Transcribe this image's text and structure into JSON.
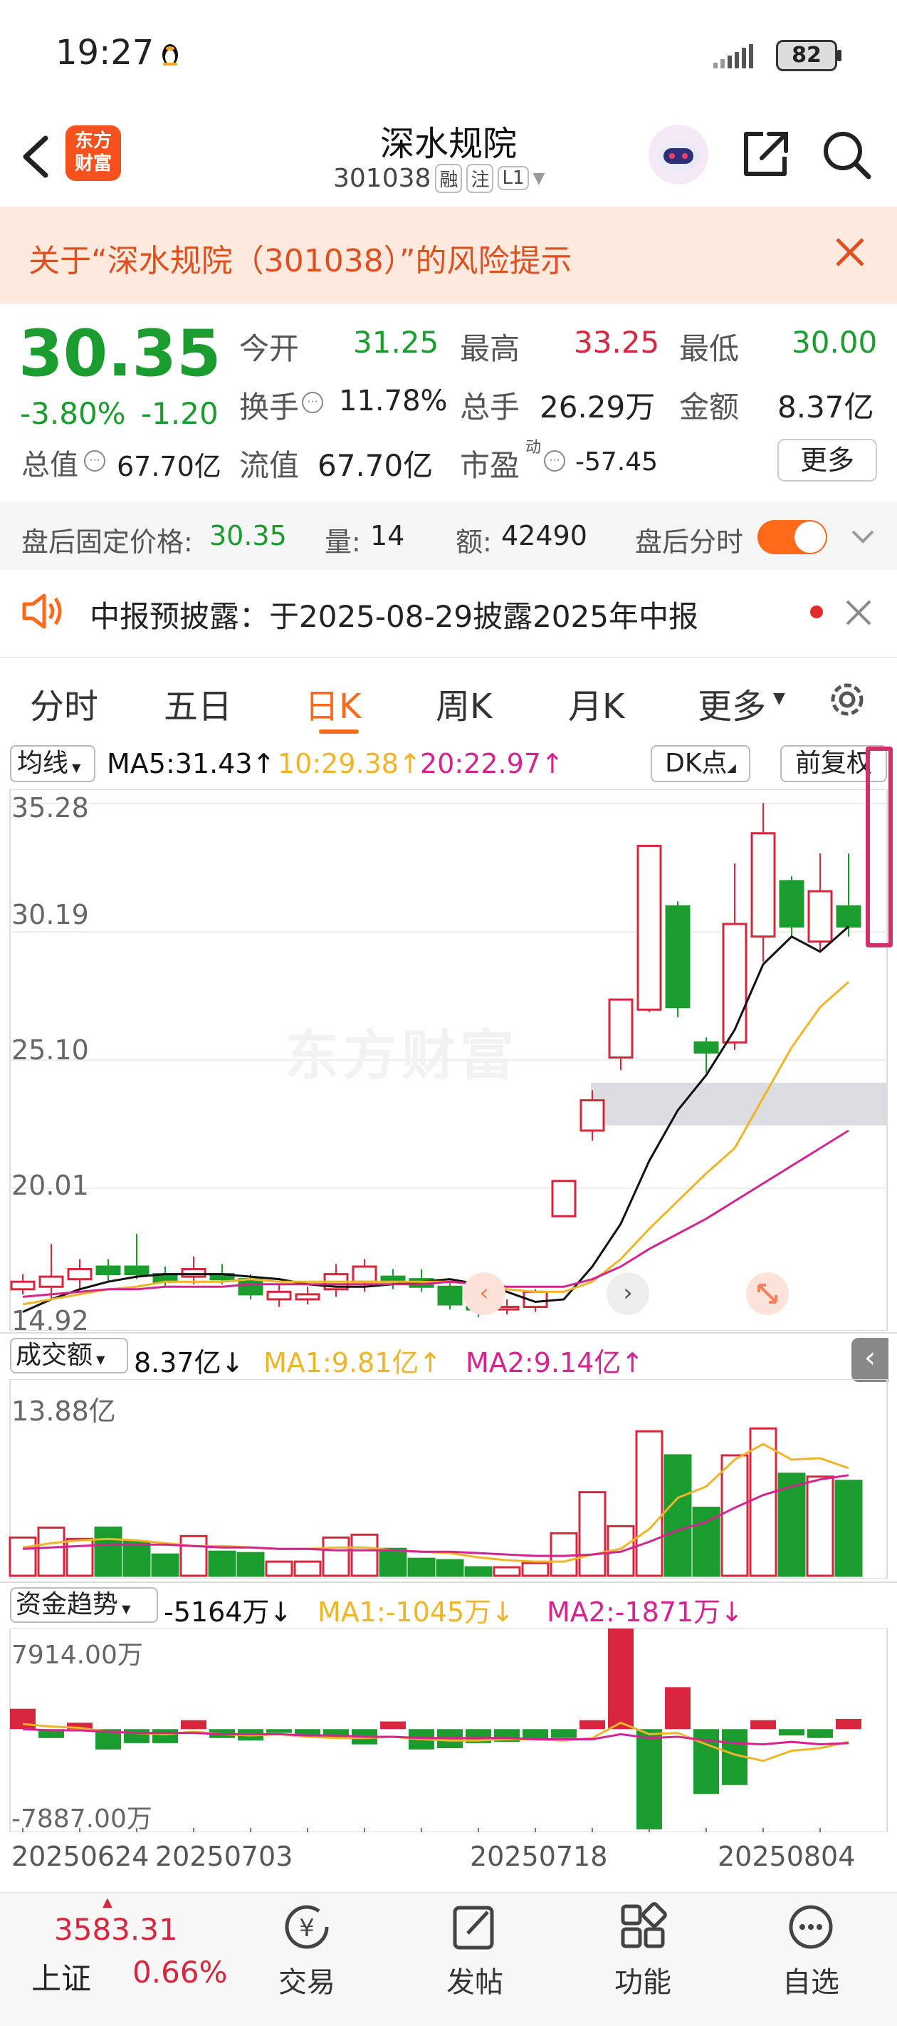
{
  "status_bar": {
    "time": "19:27",
    "battery": "82"
  },
  "header": {
    "logo_line1": "东方",
    "logo_line2": "财富",
    "title": "深水规院",
    "code": "301038",
    "tag1": "融",
    "tag2": "注",
    "tag3": "L1"
  },
  "banner": {
    "text": "关于“深水规院（301038）”的风险提示"
  },
  "quote": {
    "price": "30.35",
    "change_pct": "-3.80%",
    "change": "-1.20",
    "open_label": "今开",
    "open": "31.25",
    "high_label": "最高",
    "high": "33.25",
    "low_label": "最低",
    "low": "30.00",
    "turnover_label": "换手",
    "turnover": "11.78%",
    "volume_label": "总手",
    "volume": "26.29万",
    "amount_label": "金额",
    "amount": "8.37亿",
    "mktcap_label": "总值",
    "mktcap": "67.70亿",
    "float_label": "流值",
    "float": "67.70亿",
    "pe_label": "市盈",
    "pe_sup": "动",
    "pe": "-57.45",
    "more": "更多"
  },
  "after_hours": {
    "price_label": "盘后固定价格:",
    "price": "30.35",
    "qty_label": "量:",
    "qty": "14",
    "amt_label": "额:",
    "amt": "42490",
    "toggle_label": "盘后分时"
  },
  "notice": {
    "text": "中报预披露：于2025-08-29披露2025年中报"
  },
  "tabs": [
    "分时",
    "五日",
    "日K",
    "周K",
    "月K",
    "更多"
  ],
  "chart_toolbar": {
    "indicator": "均线",
    "ma5": "MA5:31.43↑",
    "ma10": "10:29.38↑",
    "ma20": "20:22.97↑",
    "dk": "DK点",
    "adjust": "前复权"
  },
  "price_axis": [
    "35.28",
    "30.19",
    "25.10",
    "20.01",
    "14.92"
  ],
  "vol_toolbar": {
    "label": "成交额",
    "value": "8.37亿↓",
    "ma1": "MA1:9.81亿↑",
    "ma2": "MA2:9.14亿↑"
  },
  "vol_axis": {
    "max": "13.88亿"
  },
  "flow_toolbar": {
    "label": "资金趋势",
    "value": "-5164万↓",
    "ma1": "MA1:-1045万↓",
    "ma2": "MA2:-1871万↓"
  },
  "flow_axis": {
    "max": "7914.00万",
    "min": "-7887.00万"
  },
  "dates": [
    "20250624",
    "20250703",
    "20250718",
    "20250804"
  ],
  "watermark": "东方财富",
  "bottom": {
    "index_value": "3583.31",
    "index_name": "上证",
    "index_pct": "0.66%",
    "nav": [
      "交易",
      "发帖",
      "功能",
      "自选"
    ]
  },
  "colors": {
    "up": "#d7263d",
    "down": "#1a9d2e",
    "ma5": "#111111",
    "ma10": "#f0b428",
    "ma20": "#d6248f",
    "accent": "#ff6a1a"
  },
  "chart_data": {
    "type": "candlestick",
    "ylim": [
      14.92,
      35.28
    ],
    "candles": [
      {
        "o": 16.0,
        "c": 16.3,
        "h": 16.6,
        "l": 15.8
      },
      {
        "o": 16.1,
        "c": 16.5,
        "h": 17.8,
        "l": 15.6
      },
      {
        "o": 16.4,
        "c": 16.8,
        "h": 17.2,
        "l": 16.0
      },
      {
        "o": 16.9,
        "c": 16.6,
        "h": 17.2,
        "l": 16.3
      },
      {
        "o": 16.9,
        "c": 16.6,
        "h": 18.2,
        "l": 16.4
      },
      {
        "o": 16.6,
        "c": 16.3,
        "h": 16.9,
        "l": 16.1
      },
      {
        "o": 16.5,
        "c": 16.8,
        "h": 17.3,
        "l": 16.2
      },
      {
        "o": 16.6,
        "c": 16.4,
        "h": 17.0,
        "l": 16.2
      },
      {
        "o": 16.4,
        "c": 15.8,
        "h": 16.6,
        "l": 15.6
      },
      {
        "o": 15.6,
        "c": 15.9,
        "h": 16.2,
        "l": 15.3
      },
      {
        "o": 15.6,
        "c": 15.8,
        "h": 16.1,
        "l": 15.4
      },
      {
        "o": 16.0,
        "c": 16.6,
        "h": 17.0,
        "l": 15.7
      },
      {
        "o": 16.3,
        "c": 16.9,
        "h": 17.2,
        "l": 15.9
      },
      {
        "o": 16.5,
        "c": 16.3,
        "h": 16.8,
        "l": 16.0
      },
      {
        "o": 16.4,
        "c": 16.1,
        "h": 16.8,
        "l": 15.9
      },
      {
        "o": 16.1,
        "c": 15.4,
        "h": 16.3,
        "l": 15.2
      },
      {
        "o": 15.3,
        "c": 15.2,
        "h": 15.5,
        "l": 14.9
      },
      {
        "o": 15.2,
        "c": 15.3,
        "h": 15.6,
        "l": 15.0
      },
      {
        "o": 15.3,
        "c": 15.9,
        "h": 16.0,
        "l": 15.1
      },
      {
        "o": 18.9,
        "c": 20.3,
        "h": 20.3,
        "l": 18.9
      },
      {
        "o": 22.3,
        "c": 23.5,
        "h": 23.9,
        "l": 21.9
      },
      {
        "o": 25.2,
        "c": 27.5,
        "h": 27.5,
        "l": 24.7
      },
      {
        "o": 27.1,
        "c": 33.6,
        "h": 33.6,
        "l": 27.0
      },
      {
        "o": 31.2,
        "c": 27.2,
        "h": 31.4,
        "l": 26.8
      },
      {
        "o": 25.8,
        "c": 25.4,
        "h": 26.0,
        "l": 24.6
      },
      {
        "o": 25.8,
        "c": 30.5,
        "h": 32.9,
        "l": 25.5
      },
      {
        "o": 30.0,
        "c": 34.1,
        "h": 35.3,
        "l": 29.0
      },
      {
        "o": 32.2,
        "c": 30.4,
        "h": 32.4,
        "l": 30.0
      },
      {
        "o": 29.8,
        "c": 31.8,
        "h": 33.3,
        "l": 29.4
      },
      {
        "o": 31.2,
        "c": 30.4,
        "h": 33.3,
        "l": 30.0
      }
    ],
    "ma5": [
      15.1,
      15.6,
      16.0,
      16.3,
      16.5,
      16.6,
      16.6,
      16.6,
      16.5,
      16.4,
      16.2,
      16.1,
      16.1,
      16.2,
      16.3,
      16.4,
      16.2,
      15.9,
      15.5,
      15.6,
      16.9,
      18.6,
      21.1,
      23.1,
      24.5,
      26.3,
      28.9,
      30.0,
      29.4,
      30.4,
      31.4
    ],
    "ma10": [
      15.4,
      15.6,
      15.8,
      16.0,
      16.1,
      16.3,
      16.3,
      16.3,
      16.4,
      16.3,
      16.3,
      16.3,
      16.3,
      16.3,
      16.3,
      16.3,
      16.2,
      16.0,
      15.9,
      15.9,
      16.3,
      17.2,
      18.4,
      19.5,
      20.6,
      21.6,
      23.6,
      25.6,
      27.2,
      28.2,
      29.4
    ],
    "ma20": [
      15.7,
      15.8,
      15.9,
      16.0,
      16.0,
      16.1,
      16.1,
      16.1,
      16.2,
      16.2,
      16.2,
      16.2,
      16.2,
      16.2,
      16.2,
      16.3,
      16.2,
      16.1,
      16.1,
      16.1,
      16.4,
      16.9,
      17.6,
      18.2,
      18.8,
      19.5,
      20.2,
      20.9,
      21.6,
      22.3,
      23.0
    ],
    "volume": [
      2.7,
      3.4,
      2.6,
      3.4,
      2.4,
      1.5,
      2.8,
      1.7,
      1.6,
      1.0,
      1.0,
      2.7,
      2.9,
      1.9,
      1.2,
      1.1,
      0.6,
      0.6,
      0.9,
      3.0,
      5.9,
      3.5,
      10.2,
      8.5,
      4.8,
      8.5,
      10.4,
      7.2,
      7.0,
      6.7
    ],
    "volume_ma1": [
      2.0,
      2.3,
      2.5,
      2.6,
      2.5,
      2.3,
      2.1,
      2.1,
      2.0,
      1.9,
      1.9,
      2.0,
      2.0,
      1.8,
      1.7,
      1.6,
      1.3,
      1.1,
      1.0,
      1.0,
      1.5,
      1.9,
      3.3,
      5.5,
      6.3,
      8.2,
      9.3,
      8.2,
      8.3,
      7.6,
      7.8
    ],
    "volume_ma2": [
      1.9,
      2.0,
      2.1,
      2.2,
      2.2,
      2.2,
      2.1,
      2.0,
      2.0,
      1.9,
      1.9,
      1.8,
      1.8,
      1.8,
      1.7,
      1.7,
      1.6,
      1.5,
      1.4,
      1.4,
      1.5,
      1.7,
      2.4,
      3.2,
      3.8,
      4.8,
      5.7,
      6.3,
      6.8,
      7.1,
      7.4
    ],
    "flow": [
      1600,
      -700,
      500,
      -1600,
      -1100,
      -1100,
      700,
      -700,
      -900,
      -300,
      -600,
      -700,
      -1200,
      600,
      -1600,
      -1500,
      -1100,
      -1000,
      -800,
      -700,
      700,
      7914,
      -7887,
      3300,
      -5100,
      -4400,
      700,
      -500,
      -700,
      800,
      -5164
    ],
    "flow_ma1": [
      400,
      200,
      100,
      -200,
      -300,
      -400,
      -200,
      -400,
      -500,
      -400,
      -600,
      -700,
      -700,
      -600,
      -800,
      -900,
      -900,
      -800,
      -800,
      -900,
      -700,
      500,
      -400,
      -300,
      -1200,
      -2000,
      -2500,
      -1700,
      -1500,
      -1000,
      -1045
    ],
    "flow_ma2": [
      0,
      -100,
      -100,
      -200,
      -300,
      -300,
      -300,
      -400,
      -400,
      -400,
      -500,
      -500,
      -600,
      -600,
      -700,
      -700,
      -700,
      -700,
      -800,
      -800,
      -800,
      -400,
      -700,
      -600,
      -900,
      -1100,
      -1200,
      -1000,
      -1200,
      -1100,
      -1871
    ],
    "dates": [
      "20250624",
      "20250703",
      "20250718",
      "20250804"
    ]
  }
}
